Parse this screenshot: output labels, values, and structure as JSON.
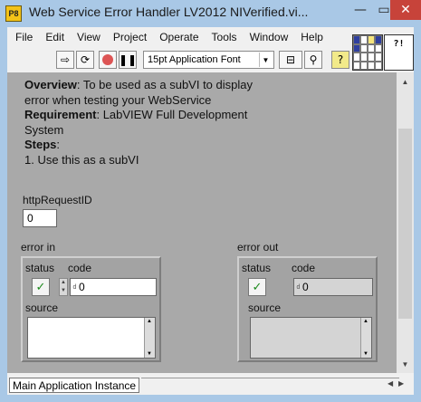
{
  "window": {
    "title": "Web Service Error Handler LV2012 NIVerified.vi...",
    "icon_label": "P8",
    "minimize_glyph": "—",
    "maximize_glyph": "▭",
    "close_glyph": "✕"
  },
  "menu": {
    "items": [
      {
        "label": "File"
      },
      {
        "label": "Edit"
      },
      {
        "label": "View"
      },
      {
        "label": "Project"
      },
      {
        "label": "Operate"
      },
      {
        "label": "Tools"
      },
      {
        "label": "Window"
      },
      {
        "label": "Help"
      }
    ]
  },
  "toolbar": {
    "run_icon": "run-arrow-icon",
    "run_continuous_icon": "run-continuously-icon",
    "abort_icon": "abort-icon",
    "pause_icon": "pause-icon",
    "font_select_value": "15pt Application Font",
    "align_icon": "align-objects-icon",
    "search_icon": "search-icon",
    "help_icon": "context-help-icon"
  },
  "vi_icon_text": "?!",
  "description": {
    "overview_label": "Overview",
    "overview_text": ": To be used as a subVI to display error when testing your WebService",
    "requirement_label": "Requirement",
    "requirement_text": ": LabVIEW Full Development System",
    "steps_label": "Steps",
    "steps_text": ":",
    "step_1": "1. Use this as a subVI"
  },
  "http_request": {
    "label": "httpRequestID",
    "value": "0"
  },
  "error_in": {
    "label": "error in",
    "status_label": "status",
    "status_glyph": "✓",
    "code_label": "code",
    "code_rep": "d",
    "code_value": "0",
    "source_label": "source",
    "source_value": ""
  },
  "error_out": {
    "label": "error out",
    "status_label": "status",
    "status_glyph": "✓",
    "code_label": "code",
    "code_rep": "d",
    "code_value": "0",
    "source_label": "source",
    "source_value": ""
  },
  "statusbar": {
    "instance": "Main Application Instance"
  }
}
